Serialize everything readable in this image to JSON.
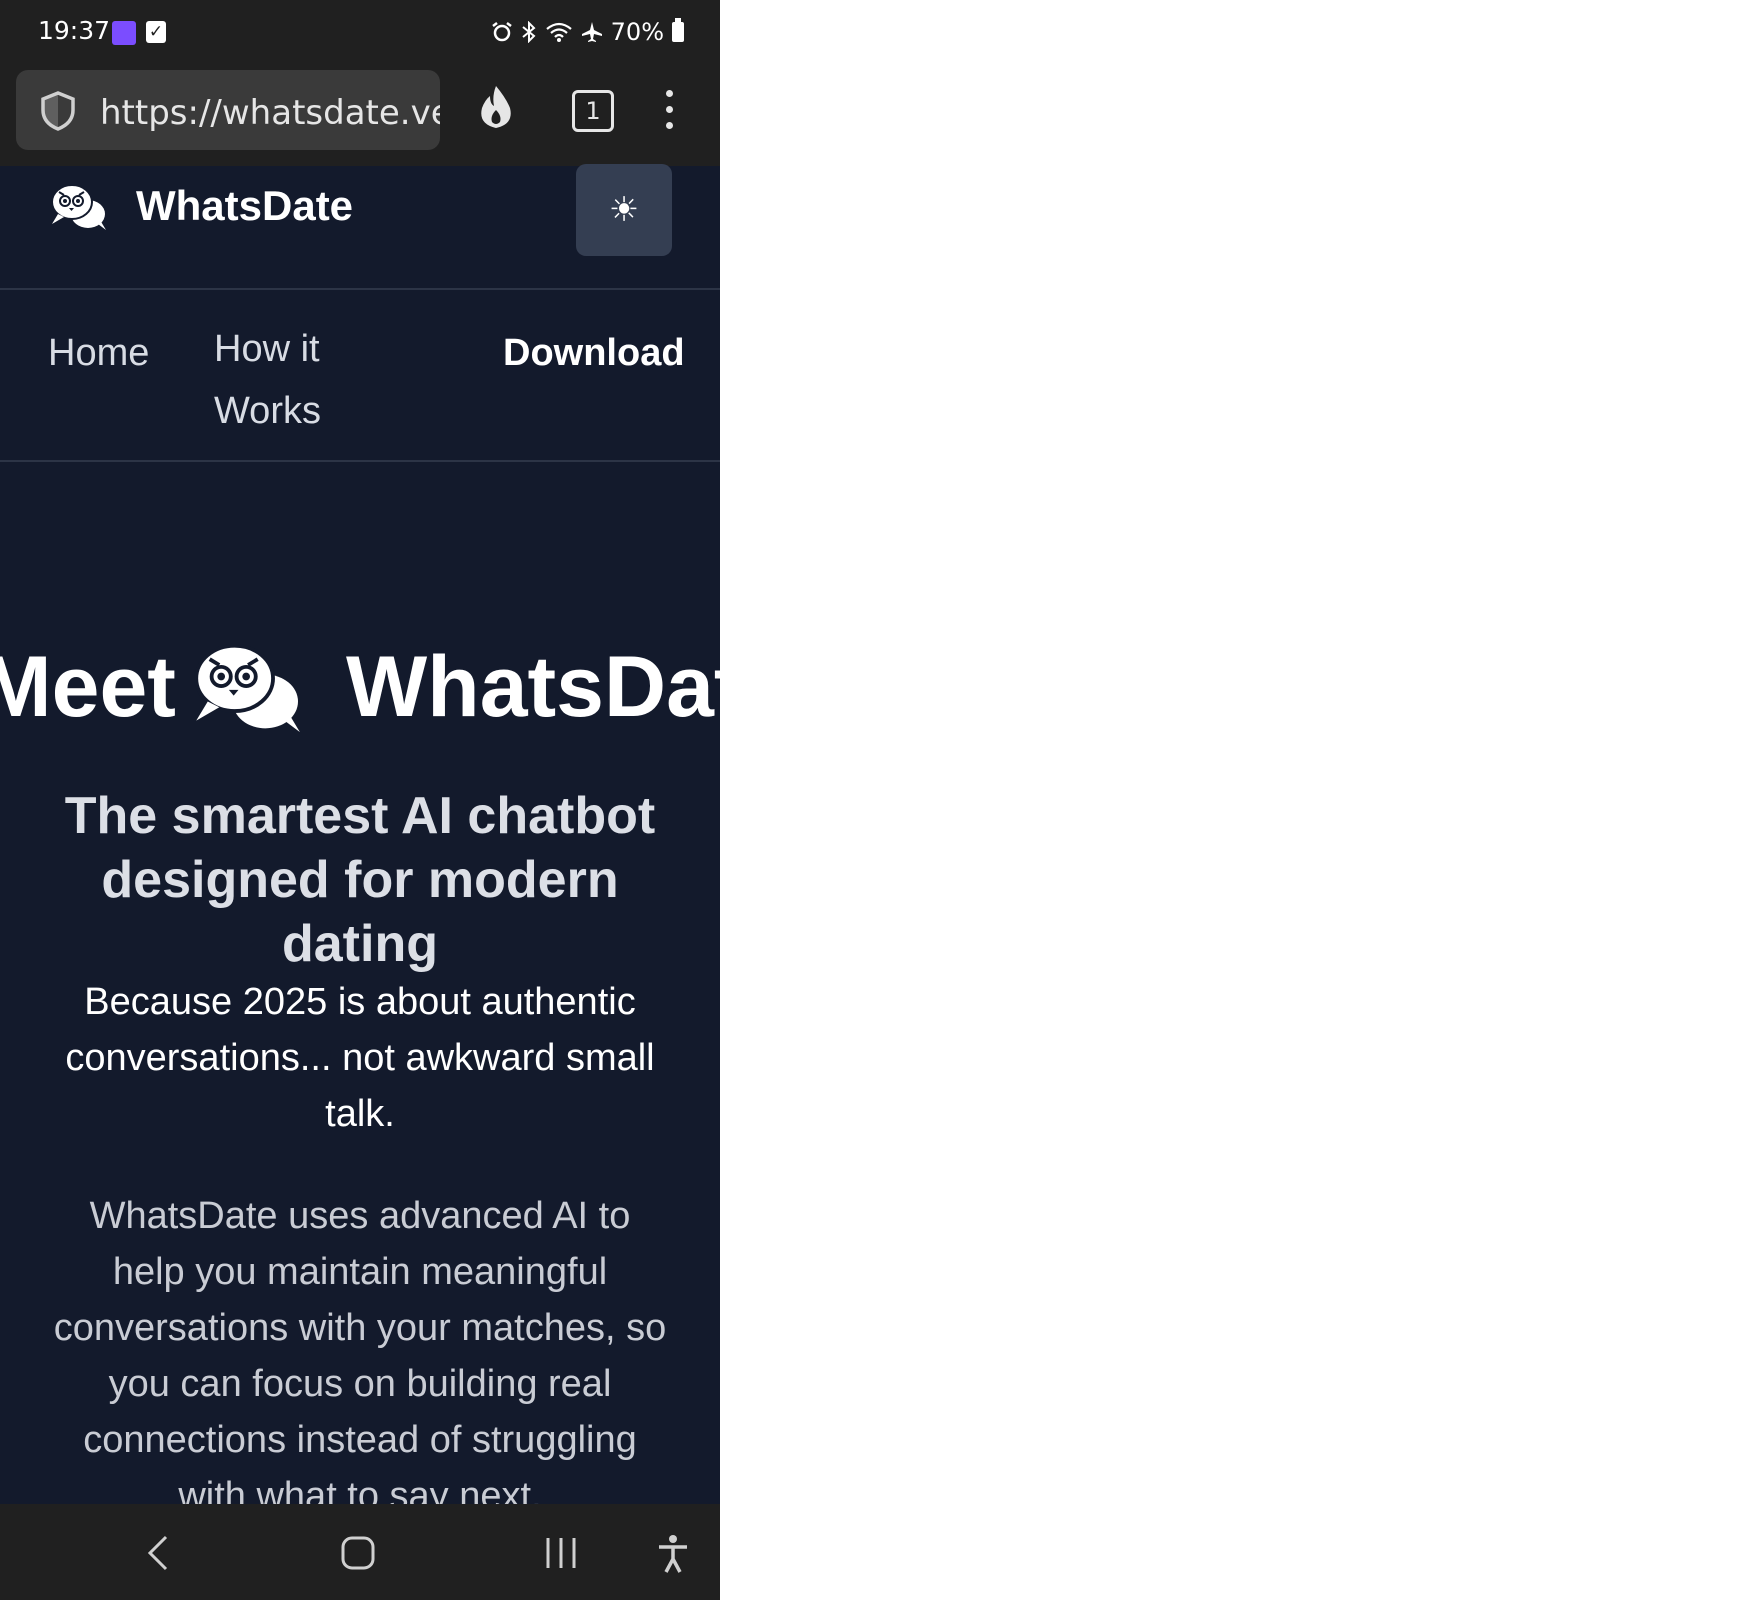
{
  "status_bar": {
    "time": "19:37",
    "battery": "70%",
    "icons": [
      "gallery-icon",
      "checkbox-icon",
      "alarm-icon",
      "bluetooth-icon",
      "wifi-icon",
      "airplane-icon",
      "battery-icon"
    ]
  },
  "browser": {
    "url": "https://whatsdate.ve",
    "tab_count": "1",
    "icons": [
      "shield-icon",
      "flame-icon",
      "tabs-icon",
      "more-menu-icon"
    ]
  },
  "header": {
    "brand": "WhatsDate",
    "theme_toggle_glyph": "☀"
  },
  "nav": {
    "home": "Home",
    "how_it_works": "How it Works",
    "download": "Download"
  },
  "hero": {
    "title_prefix": "Meet",
    "title_brand": "WhatsDate",
    "subtitle": "The smartest AI chatbot designed for modern dating",
    "tagline": "Because 2025 is about authentic conversations... not awkward small talk.",
    "description": "WhatsDate uses advanced AI to help you maintain meaningful conversations with your matches, so you can focus on building real connections instead of struggling with what to say next."
  },
  "colors": {
    "page_bg": "#131a2c",
    "system_bar_bg": "#202020",
    "toggle_bg": "#343e52"
  }
}
